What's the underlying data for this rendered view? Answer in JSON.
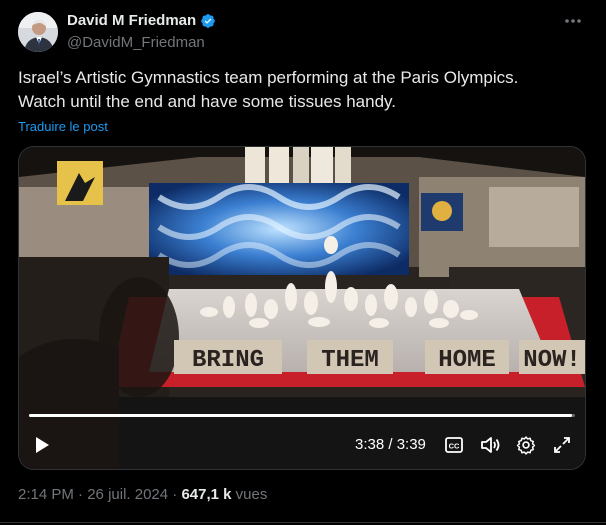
{
  "author": {
    "display_name": "David M Friedman",
    "handle": "@DavidM_Friedman",
    "verified": true,
    "verified_color": "#1d9bf0"
  },
  "tweet": {
    "text_line1": "Israel’s Artistic Gymnastics team performing at the Paris Olympics.",
    "text_line2": "Watch until the end and have some tissues handy.",
    "translate_label": "Traduire le post"
  },
  "video": {
    "banner_words": [
      "BRING",
      "THEM",
      "HOME",
      "NOW!"
    ],
    "current_time": "3:38",
    "duration": "3:39",
    "time_display": "3:38 / 3:39",
    "progress_fraction": 0.995,
    "controls": [
      "play-icon",
      "captions-icon",
      "volume-icon",
      "settings-icon",
      "fullscreen-icon"
    ]
  },
  "meta": {
    "time": "2:14 PM",
    "separator": " · ",
    "date": "26 juil. 2024",
    "views_count": "647,1 k",
    "views_label": " vues"
  },
  "colors": {
    "background": "#000000",
    "text_primary": "#e7e9ea",
    "text_secondary": "#71767b",
    "link": "#1d9bf0"
  }
}
